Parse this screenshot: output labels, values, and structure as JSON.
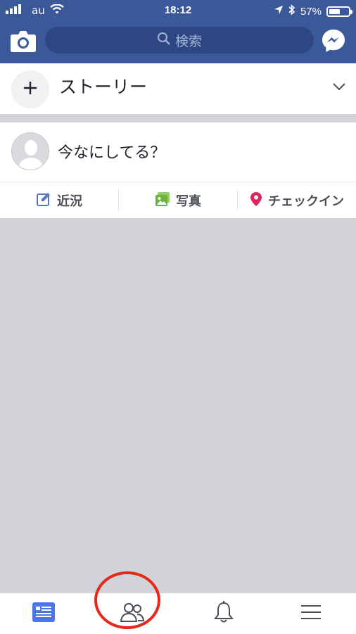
{
  "status_bar": {
    "carrier": "au",
    "time": "18:12",
    "battery_percent_label": "57%",
    "battery_level": 0.57
  },
  "header": {
    "search_placeholder": "検索",
    "icons": {
      "left": "camera-icon",
      "right": "messenger-icon",
      "search": "search-icon"
    }
  },
  "stories": {
    "label": "ストーリー",
    "icons": {
      "add": "plus-icon",
      "expand": "chevron-down-icon"
    }
  },
  "composer": {
    "prompt": "今なにしてる？"
  },
  "actions": [
    {
      "label": "近況",
      "icon": "edit-icon"
    },
    {
      "label": "写真",
      "icon": "photo-icon"
    },
    {
      "label": "チェックイン",
      "icon": "location-pin-icon"
    }
  ],
  "tab_bar": {
    "tabs": [
      {
        "icon": "news-feed-icon",
        "active": true
      },
      {
        "icon": "friends-icon",
        "active": false
      },
      {
        "icon": "bell-icon",
        "active": false
      },
      {
        "icon": "menu-icon",
        "active": false
      }
    ],
    "highlight": {
      "target": "friends-icon",
      "color": "#e52a1c"
    }
  },
  "colors": {
    "brand": "#3b5998",
    "search_bg": "#2d4785",
    "feed_bg": "#d1d3d8",
    "active_tab": "#4a76e8",
    "photo_green": "#6bb33d",
    "checkin_pink": "#e0245e",
    "edit_blue": "#5876c4"
  }
}
